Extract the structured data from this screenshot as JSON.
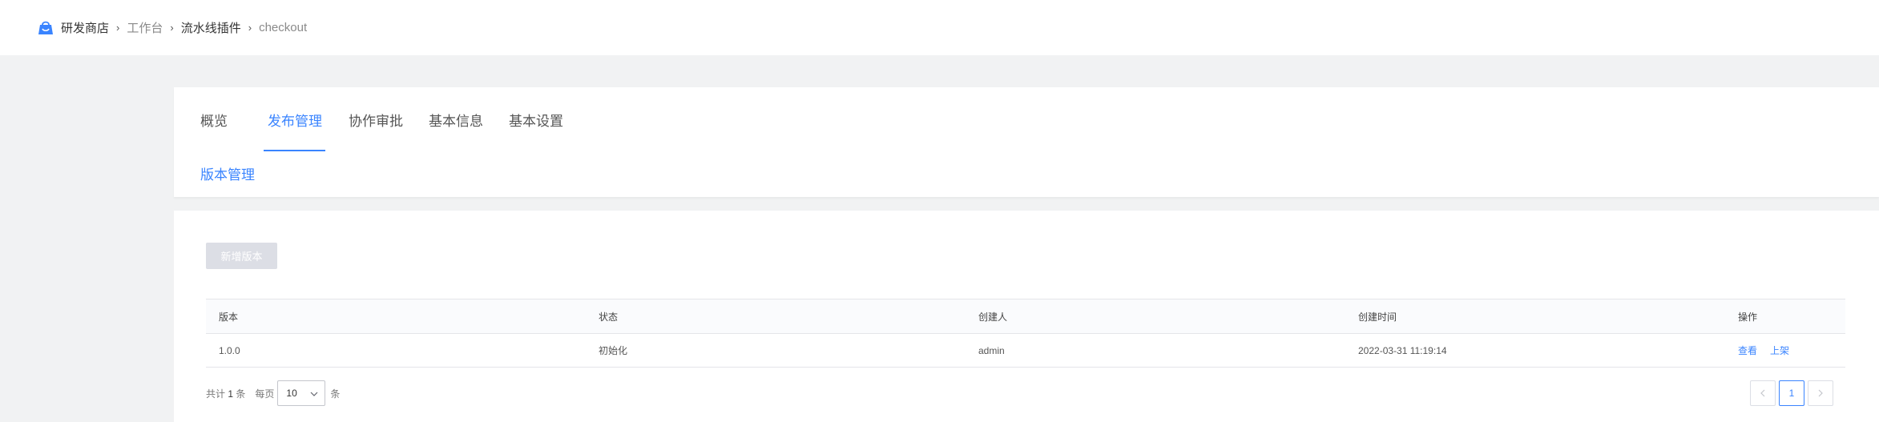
{
  "breadcrumb": {
    "items": [
      {
        "label": "研发商店",
        "style": "strong"
      },
      {
        "label": "工作台",
        "style": "muted"
      },
      {
        "label": "流水线插件",
        "style": "strong"
      },
      {
        "label": "checkout",
        "style": "muted"
      }
    ],
    "logo_icon": "store-bag-icon"
  },
  "tabs": {
    "items": [
      {
        "label": "概览"
      },
      {
        "label": "发布管理",
        "active": true
      },
      {
        "label": "协作审批"
      },
      {
        "label": "基本信息"
      },
      {
        "label": "基本设置"
      }
    ],
    "subtab": "版本管理"
  },
  "toolbar": {
    "new_version_label": "新增版本",
    "new_version_disabled": true
  },
  "table": {
    "columns": [
      "版本",
      "状态",
      "创建人",
      "创建时间",
      "操作"
    ],
    "rows": [
      {
        "version": "1.0.0",
        "status": "初始化",
        "creator": "admin",
        "created_at": "2022-03-31 11:19:14",
        "actions": [
          "查看",
          "上架"
        ]
      }
    ]
  },
  "pagination": {
    "total_prefix": "共计",
    "total": "1",
    "total_suffix": "条",
    "per_page_prefix": "每页",
    "per_page": "10",
    "per_page_suffix": "条",
    "current_page": "1"
  },
  "colors": {
    "accent": "#3a84ff",
    "page_bg": "#f1f2f3",
    "disabled_button": "#dcdee5"
  }
}
